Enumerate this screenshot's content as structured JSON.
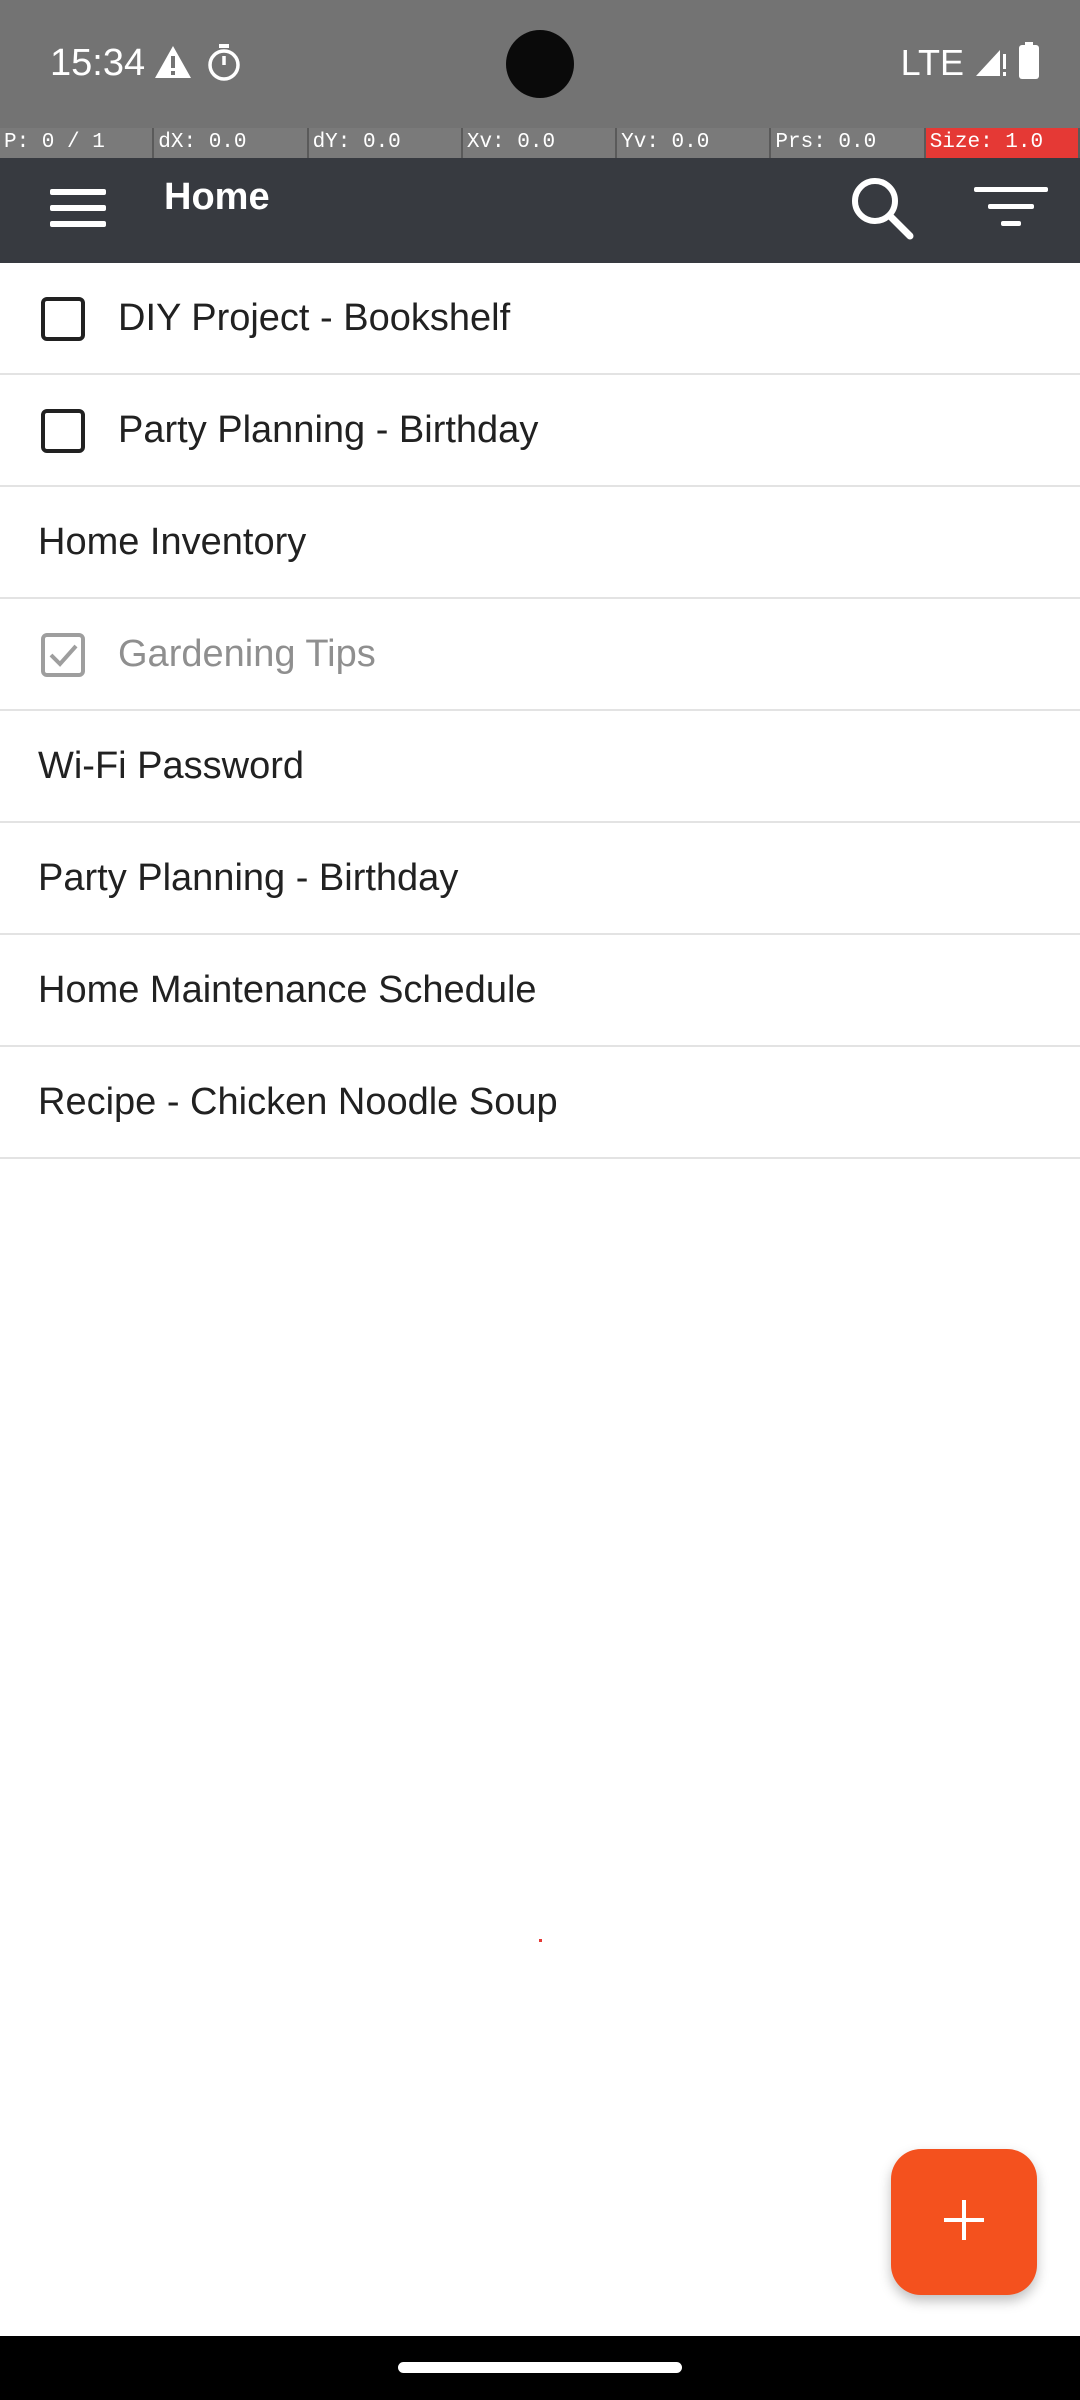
{
  "status_bar": {
    "time": "15:34",
    "network": "LTE",
    "icons": [
      "warning-icon",
      "timer-icon",
      "signal-icon",
      "battery-icon"
    ]
  },
  "debug_overlay": [
    "P: 0 / 1",
    "dX: 0.0",
    "dY: 0.0",
    "Xv: 0.0",
    "Yv: 0.0",
    "Prs: 0.0",
    "Size: 1.0"
  ],
  "app_bar": {
    "title": "Home",
    "menu_icon": "hamburger-menu-icon",
    "search_icon": "search-icon",
    "filter_icon": "filter-sort-icon",
    "background": "#373a40"
  },
  "list": {
    "items": [
      {
        "label": "DIY Project - Bookshelf",
        "type": "task",
        "checked": false
      },
      {
        "label": "Party Planning - Birthday",
        "type": "task",
        "checked": false
      },
      {
        "label": "Home Inventory",
        "type": "list"
      },
      {
        "label": "Gardening Tips",
        "type": "task",
        "checked": true
      },
      {
        "label": "Wi-Fi Password",
        "type": "list"
      },
      {
        "label": "Party Planning - Birthday",
        "type": "list"
      },
      {
        "label": "Home Maintenance Schedule",
        "type": "list"
      },
      {
        "label": "Recipe - Chicken Noodle Soup",
        "type": "list"
      }
    ]
  },
  "fab": {
    "icon": "plus-icon",
    "color": "#f4511e"
  },
  "colors": {
    "accent": "#f4511e",
    "alert": "#e53935",
    "text_primary": "#212121",
    "text_muted": "#8f8f8f"
  }
}
